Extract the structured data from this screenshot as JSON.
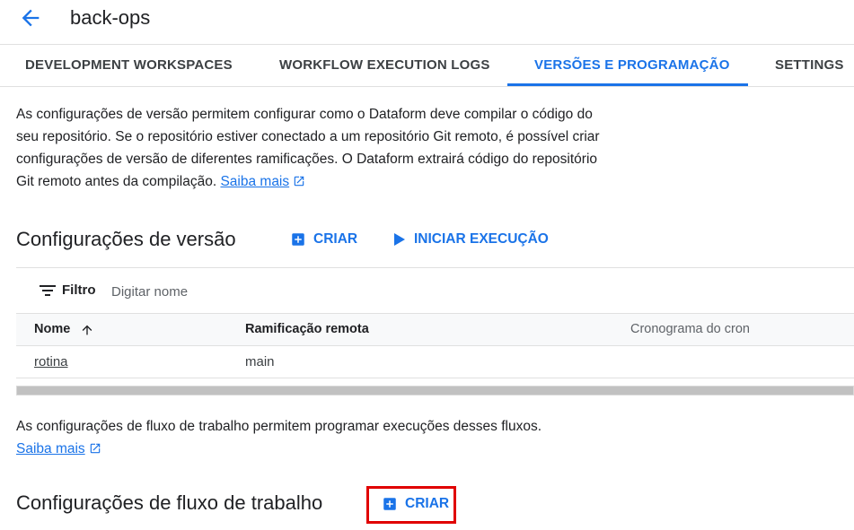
{
  "header": {
    "back_icon": "arrow-back-icon",
    "title": "back-ops"
  },
  "tabs": [
    {
      "label": "DEVELOPMENT WORKSPACES",
      "active": false
    },
    {
      "label": "WORKFLOW EXECUTION LOGS",
      "active": false
    },
    {
      "label": "VERSÕES E PROGRAMAÇÃO",
      "active": true
    },
    {
      "label": "SETTINGS",
      "active": false
    }
  ],
  "intro": {
    "text": "As configurações de versão permitem configurar como o Dataform deve compilar o código do seu repositório. Se o repositório estiver conectado a um repositório Git remoto, é possível criar configurações de versão de diferentes ramificações. O Dataform extrairá código do repositório Git remoto antes da compilação.",
    "link": "Saiba mais"
  },
  "release_section": {
    "title": "Configurações de versão",
    "create_label": "CRIAR",
    "run_label": "INICIAR EXECUÇÃO"
  },
  "table": {
    "filter_label": "Filtro",
    "filter_placeholder": "Digitar nome",
    "columns": [
      "Nome",
      "Ramificação remota",
      "Cronograma do cron"
    ],
    "sort_icon": "arrow-upward-icon",
    "rows": [
      {
        "name": "rotina",
        "branch": "main",
        "cron": ""
      }
    ]
  },
  "workflow_intro": {
    "text": "As configurações de fluxo de trabalho permitem programar execuções desses fluxos.",
    "link": "Saiba mais"
  },
  "workflow_section": {
    "title": "Configurações de fluxo de trabalho",
    "create_label": "CRIAR"
  },
  "colors": {
    "accent": "#1a73e8",
    "highlight": "#e00000"
  }
}
